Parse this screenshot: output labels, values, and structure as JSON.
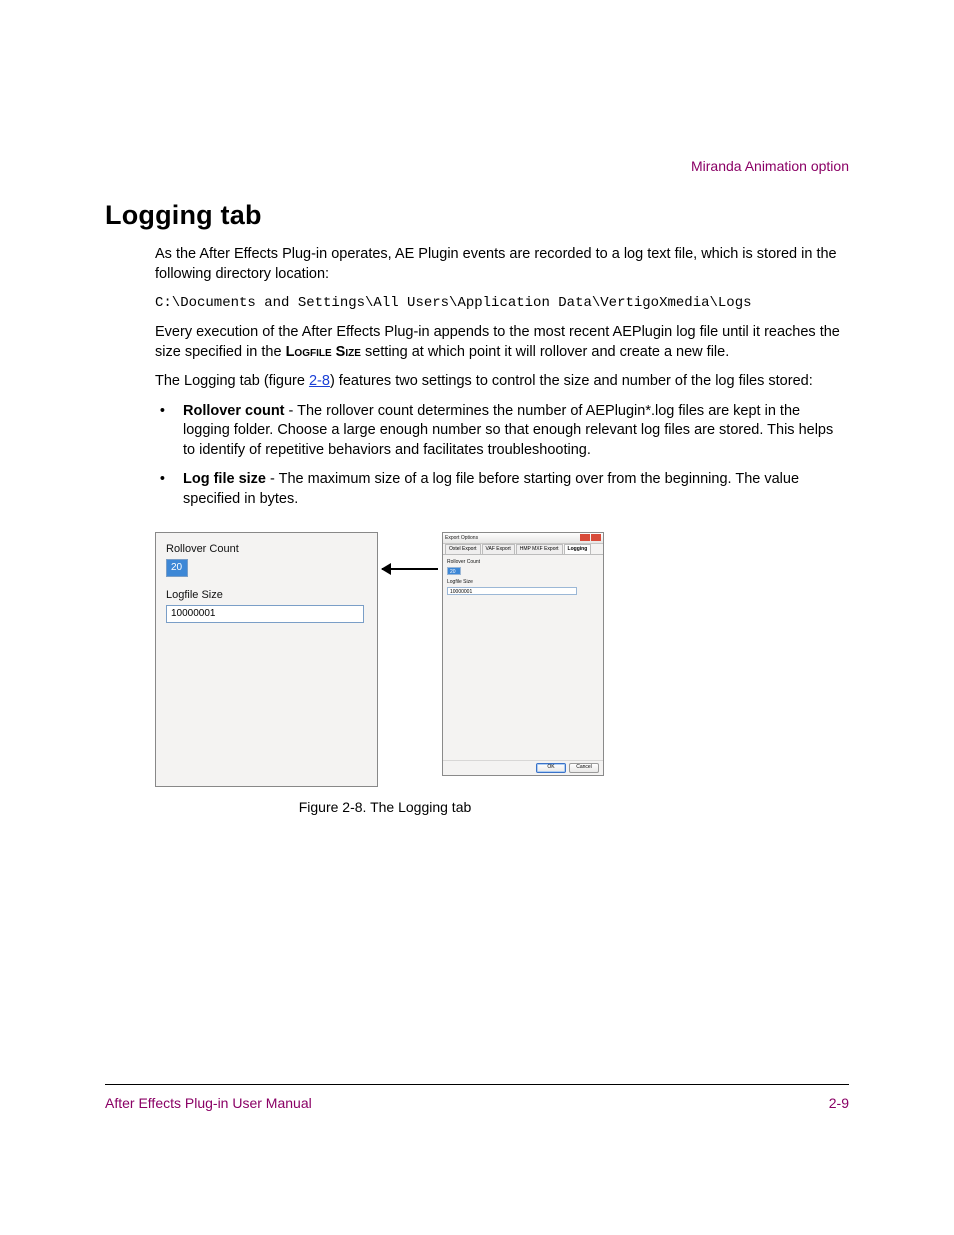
{
  "header": {
    "right": "Miranda Animation option"
  },
  "title": "Logging tab",
  "para1a": "As the After Effects Plug-in operates, AE Plugin events are recorded to a log text file, which is stored in the following directory location:",
  "path": "C:\\Documents and Settings\\All Users\\Application Data\\VertigoXmedia\\Logs",
  "para2_pre": "Every execution of the After Effects Plug-in appends to the most recent AEPlugin log file until it reaches the size specified in the ",
  "para2_caps": "Logfile Size",
  "para2_post": " setting at which point it will rollover and create a new file.",
  "para3_pre": "The Logging tab (figure ",
  "para3_link": "2-8",
  "para3_post": ") features two settings to control the size and number of the log files stored:",
  "bullets": [
    {
      "label": "Rollover count",
      "text": " - The rollover count determines the number of AEPlugin*.log files are kept in the logging folder. Choose a large enough number so that enough relevant log files are stored. This helps to identify of repetitive behaviors and facilitates troubleshooting."
    },
    {
      "label": "Log file size",
      "text": " - The maximum size of a log file before starting over from the beginning. The value specified in bytes."
    }
  ],
  "zoom": {
    "rollover_label": "Rollover Count",
    "rollover_value": "20",
    "logfile_label": "Logfile Size",
    "logfile_value": "10000001"
  },
  "dialog": {
    "title": "Export Options",
    "tabs": [
      "Oxtel Export",
      "VAF Export",
      "HMP MXF Export",
      "Logging"
    ],
    "active_tab": 3,
    "rollover_label": "Rollover Count",
    "rollover_value": "20",
    "logfile_label": "Logfile Size",
    "logfile_value": "10000001",
    "ok": "OK",
    "cancel": "Cancel"
  },
  "figure_caption": "Figure 2-8. The Logging tab",
  "footer": {
    "left": "After Effects Plug-in User Manual",
    "right": "2-9"
  }
}
